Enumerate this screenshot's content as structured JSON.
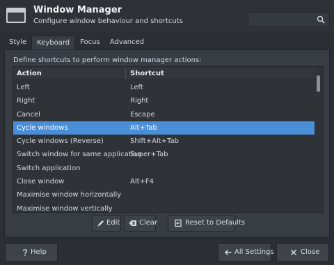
{
  "header": {
    "title": "Window Manager",
    "subtitle": "Configure window behaviour and shortcuts",
    "search_placeholder": ""
  },
  "tabs": [
    {
      "label": "Style",
      "active": false
    },
    {
      "label": "Keyboard",
      "active": true
    },
    {
      "label": "Focus",
      "active": false
    },
    {
      "label": "Advanced",
      "active": false
    }
  ],
  "panel": {
    "description": "Define shortcuts to perform window manager actions:",
    "columns": {
      "action": "Action",
      "shortcut": "Shortcut"
    },
    "rows": [
      {
        "action": "Left",
        "shortcut": "Left",
        "selected": false
      },
      {
        "action": "Right",
        "shortcut": "Right",
        "selected": false
      },
      {
        "action": "Cancel",
        "shortcut": "Escape",
        "selected": false
      },
      {
        "action": "Cycle windows",
        "shortcut": "Alt+Tab",
        "selected": true
      },
      {
        "action": "Cycle windows (Reverse)",
        "shortcut": "Shift+Alt+Tab",
        "selected": false
      },
      {
        "action": "Switch window for same application",
        "shortcut": "Super+Tab",
        "selected": false
      },
      {
        "action": "Switch application",
        "shortcut": "",
        "selected": false
      },
      {
        "action": "Close window",
        "shortcut": "Alt+F4",
        "selected": false
      },
      {
        "action": "Maximise window horizontally",
        "shortcut": "",
        "selected": false
      },
      {
        "action": "Maximise window vertically",
        "shortcut": "",
        "selected": false
      }
    ],
    "buttons": {
      "edit": "Edit",
      "clear": "Clear",
      "reset": "Reset to Defaults"
    }
  },
  "footer": {
    "help": "Help",
    "all_settings": "All Settings",
    "close": "Close"
  },
  "colors": {
    "background": "#2b2e33",
    "selection": "#4a8ed8",
    "text": "#d3dae3"
  },
  "icons": {
    "app": "window-manager-icon",
    "search": "search-icon",
    "edit": "pencil-icon",
    "clear": "backspace-icon",
    "reset": "reset-icon",
    "help": "question-icon",
    "all_settings": "arrow-left-icon",
    "close": "close-icon"
  }
}
